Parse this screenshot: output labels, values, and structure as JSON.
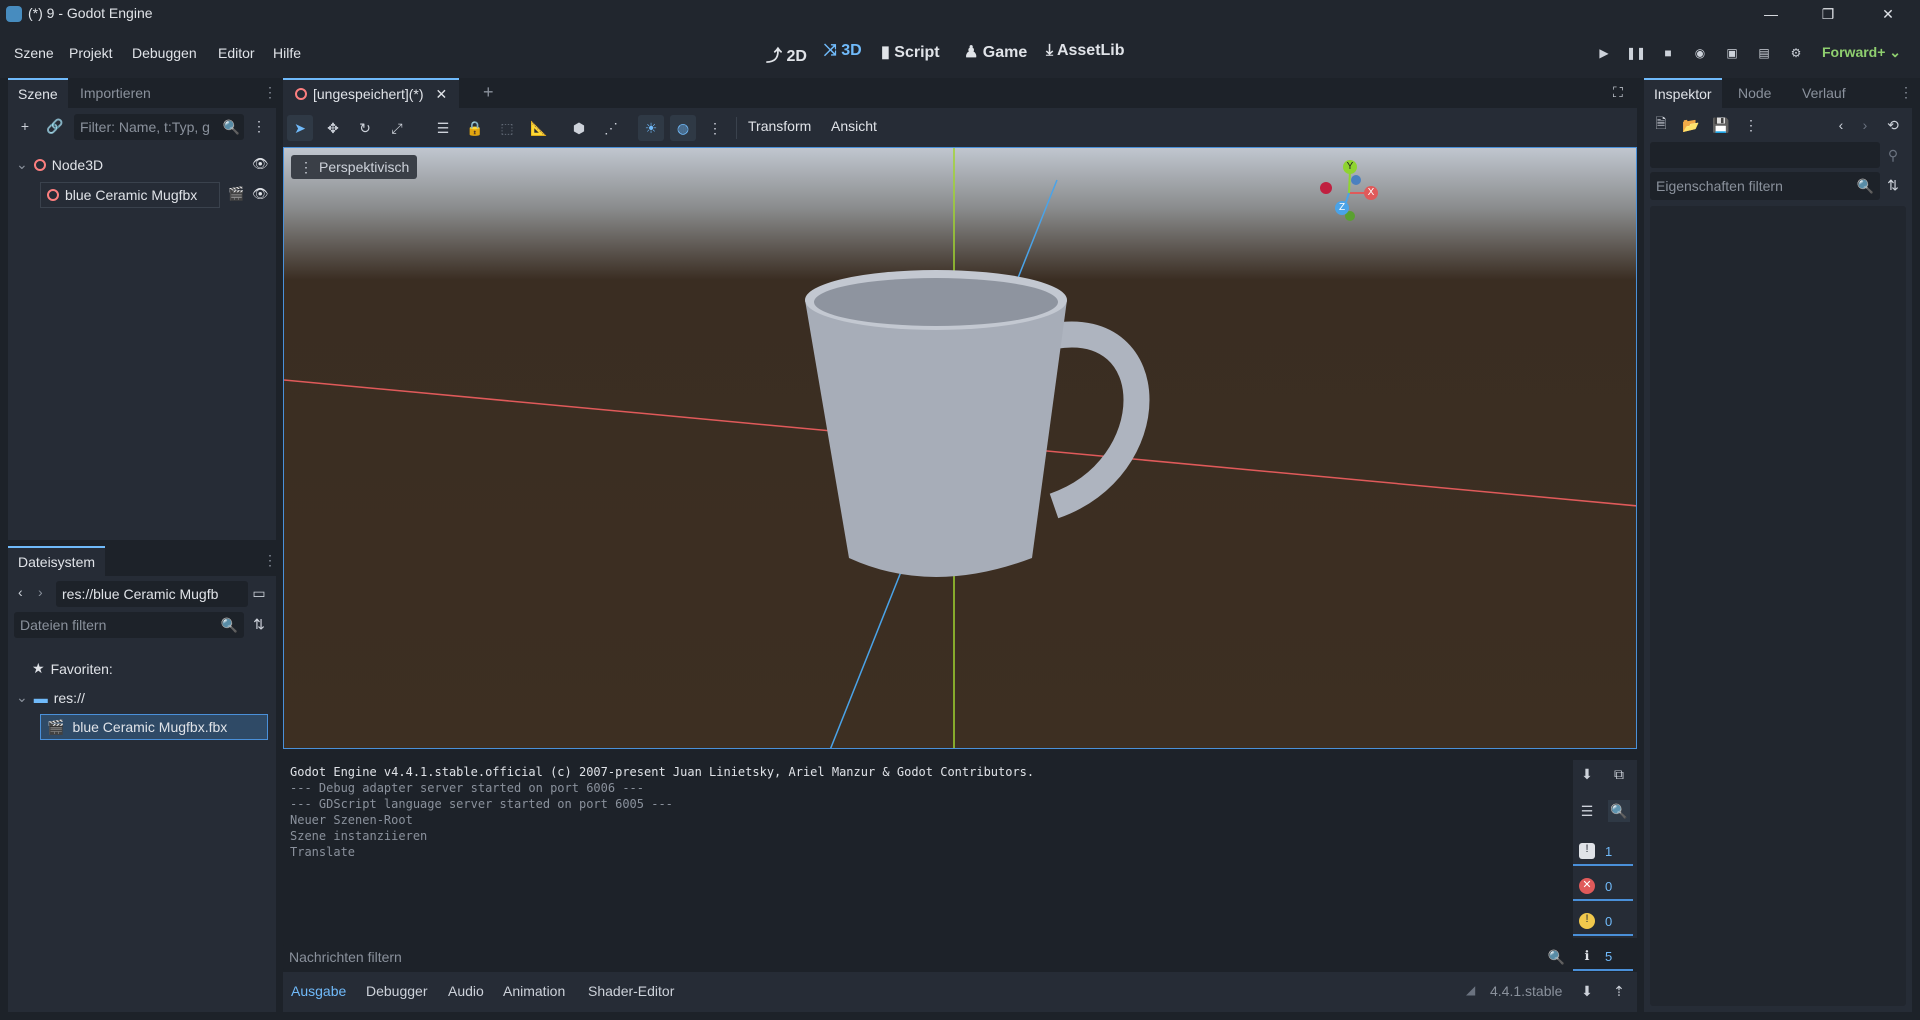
{
  "window": {
    "title": "(*) 9 - Godot Engine",
    "minimize": "—",
    "maximize": "❐",
    "close": "✕"
  },
  "menus": [
    "Szene",
    "Projekt",
    "Debuggen",
    "Editor",
    "Hilfe"
  ],
  "modes": [
    {
      "label": "2D",
      "icon": "2d-icon"
    },
    {
      "label": "3D",
      "icon": "3d-icon",
      "active": true
    },
    {
      "label": "Script",
      "icon": "script-icon"
    },
    {
      "label": "Game",
      "icon": "game-icon"
    },
    {
      "label": "AssetLib",
      "icon": "assetlib-icon"
    }
  ],
  "renderer": "Forward+",
  "scene_dock": {
    "tabs": [
      "Szene",
      "Importieren"
    ],
    "filter_placeholder": "Filter: Name, t:Typ, g",
    "nodes": [
      {
        "name": "Node3D",
        "level": 0
      },
      {
        "name": "blue Ceramic Mugfbx",
        "level": 1
      }
    ]
  },
  "filesystem_dock": {
    "tab": "Dateisystem",
    "path": "res://blue Ceramic Mugfb",
    "filter_placeholder": "Dateien filtern",
    "favorites": "Favoriten:",
    "root": "res://",
    "files": [
      "blue Ceramic Mugfbx.fbx"
    ]
  },
  "editor_tab": {
    "label": "[ungespeichert](*)",
    "close": "✕",
    "add": "+"
  },
  "viewport": {
    "toolbar_menus": [
      "Transform",
      "Ansicht"
    ],
    "perspective_label": "Perspektivisch",
    "gizmo_axes": [
      "X",
      "Y",
      "Z"
    ]
  },
  "inspector_dock": {
    "tabs": [
      "Inspektor",
      "Node",
      "Verlauf"
    ],
    "filter_placeholder": "Eigenschaften filtern"
  },
  "output": {
    "lines": [
      "Godot Engine v4.4.1.stable.official (c) 2007-present Juan Linietsky, Ariel Manzur & Godot Contributors.",
      "--- Debug adapter server started on port 6006 ---",
      "--- GDScript language server started on port 6005 ---",
      "Neuer Szenen-Root",
      "Szene instanziieren",
      "Translate"
    ],
    "filter_placeholder": "Nachrichten filtern",
    "counters": {
      "messages": "1",
      "errors": "0",
      "warnings": "0",
      "info": "5"
    }
  },
  "bottom_tabs": [
    "Ausgabe",
    "Debugger",
    "Audio",
    "Animation",
    "Shader-Editor"
  ],
  "version": "4.4.1.stable"
}
